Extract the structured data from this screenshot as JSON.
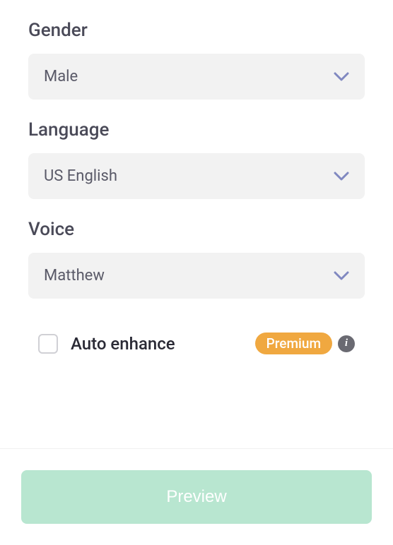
{
  "fields": {
    "gender": {
      "label": "Gender",
      "value": "Male"
    },
    "language": {
      "label": "Language",
      "value": "US English"
    },
    "voice": {
      "label": "Voice",
      "value": "Matthew"
    }
  },
  "autoEnhance": {
    "label": "Auto enhance",
    "badge": "Premium"
  },
  "footer": {
    "previewLabel": "Preview"
  },
  "colors": {
    "chevron": "#8088c0",
    "badge": "#f0a840",
    "previewBg": "#b8e6d0"
  }
}
